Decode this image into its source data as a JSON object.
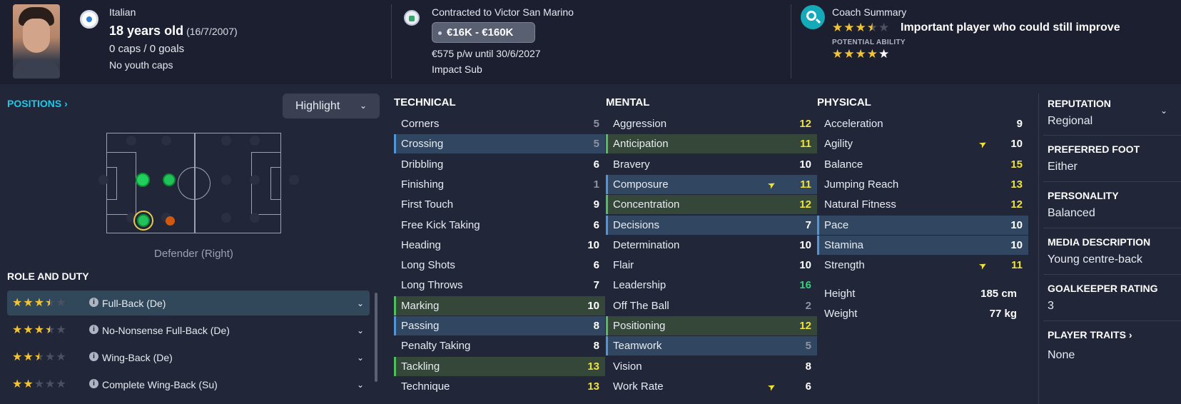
{
  "header": {
    "nationality": "Italian",
    "age": "18 years old",
    "dob": "(16/7/2007)",
    "caps": "0 caps / 0 goals",
    "youth_caps": "No youth caps",
    "contract": "Contracted to Victor San Marino",
    "value_range": "€16K - €160K",
    "wage": "€575 p/w until 30/6/2027",
    "squad_status": "Impact Sub",
    "coach_title": "Coach Summary",
    "coach_stars": 3.5,
    "coach_text": "Important player who could still improve",
    "pa_label": "POTENTIAL ABILITY",
    "pa_stars": 4.5
  },
  "left": {
    "positions_label": "POSITIONS",
    "highlight_label": "Highlight",
    "position_caption": "Defender (Right)",
    "role_title": "ROLE AND DUTY",
    "roles": [
      {
        "stars": 3.5,
        "label": "Full-Back (De)"
      },
      {
        "stars": 3.5,
        "label": "No-Nonsense Full-Back (De)"
      },
      {
        "stars": 2.5,
        "label": "Wing-Back (De)"
      },
      {
        "stars": 2,
        "label": "Complete Wing-Back (Su)"
      }
    ]
  },
  "technical": {
    "title": "TECHNICAL",
    "attrs": [
      {
        "name": "Corners",
        "value": "5"
      },
      {
        "name": "Crossing",
        "value": "5"
      },
      {
        "name": "Dribbling",
        "value": "6"
      },
      {
        "name": "Finishing",
        "value": "1"
      },
      {
        "name": "First Touch",
        "value": "9"
      },
      {
        "name": "Free Kick Taking",
        "value": "6"
      },
      {
        "name": "Heading",
        "value": "10"
      },
      {
        "name": "Long Shots",
        "value": "6"
      },
      {
        "name": "Long Throws",
        "value": "7"
      },
      {
        "name": "Marking",
        "value": "10"
      },
      {
        "name": "Passing",
        "value": "8"
      },
      {
        "name": "Penalty Taking",
        "value": "8"
      },
      {
        "name": "Tackling",
        "value": "13"
      },
      {
        "name": "Technique",
        "value": "13"
      }
    ]
  },
  "mental": {
    "title": "MENTAL",
    "attrs": [
      {
        "name": "Aggression",
        "value": "12"
      },
      {
        "name": "Anticipation",
        "value": "11"
      },
      {
        "name": "Bravery",
        "value": "10"
      },
      {
        "name": "Composure",
        "value": "11"
      },
      {
        "name": "Concentration",
        "value": "12"
      },
      {
        "name": "Decisions",
        "value": "7"
      },
      {
        "name": "Determination",
        "value": "10"
      },
      {
        "name": "Flair",
        "value": "10"
      },
      {
        "name": "Leadership",
        "value": "16"
      },
      {
        "name": "Off The Ball",
        "value": "2"
      },
      {
        "name": "Positioning",
        "value": "12"
      },
      {
        "name": "Teamwork",
        "value": "5"
      },
      {
        "name": "Vision",
        "value": "8"
      },
      {
        "name": "Work Rate",
        "value": "6"
      }
    ]
  },
  "physical": {
    "title": "PHYSICAL",
    "attrs": [
      {
        "name": "Acceleration",
        "value": "9"
      },
      {
        "name": "Agility",
        "value": "10"
      },
      {
        "name": "Balance",
        "value": "15"
      },
      {
        "name": "Jumping Reach",
        "value": "13"
      },
      {
        "name": "Natural Fitness",
        "value": "12"
      },
      {
        "name": "Pace",
        "value": "10"
      },
      {
        "name": "Stamina",
        "value": "10"
      },
      {
        "name": "Strength",
        "value": "11"
      }
    ],
    "height_label": "Height",
    "height": "185 cm",
    "weight_label": "Weight",
    "weight": "77 kg"
  },
  "sidebar": {
    "reputation_label": "REPUTATION",
    "reputation": "Regional",
    "foot_label": "PREFERRED FOOT",
    "foot": "Either",
    "personality_label": "PERSONALITY",
    "personality": "Balanced",
    "media_label": "MEDIA DESCRIPTION",
    "media": "Young centre-back",
    "gk_label": "GOALKEEPER RATING",
    "gk": "3",
    "traits_label": "PLAYER TRAITS",
    "traits": "None"
  },
  "colors": {
    "accent": "#1ec8e6",
    "star": "#f2c335",
    "value_high": "#f0e23a",
    "value_top": "#35d07a"
  }
}
